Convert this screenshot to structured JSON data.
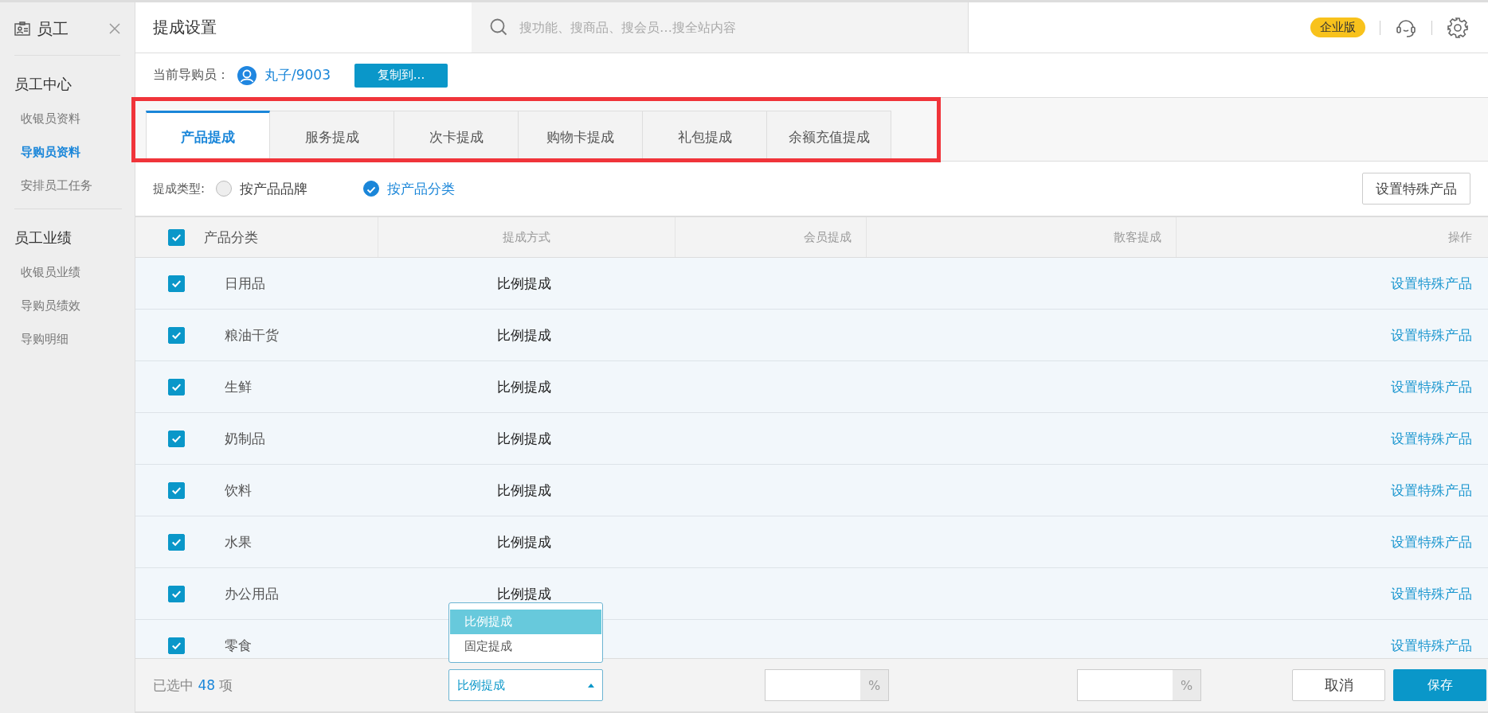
{
  "sidebar": {
    "title": "员工",
    "groups": [
      {
        "title": "员工中心",
        "items": [
          {
            "label": "收银员资料",
            "selected": false
          },
          {
            "label": "导购员资料",
            "selected": true
          },
          {
            "label": "安排员工任务",
            "selected": false
          }
        ]
      },
      {
        "title": "员工业绩",
        "items": [
          {
            "label": "收银员业绩",
            "selected": false
          },
          {
            "label": "导购员绩效",
            "selected": false
          },
          {
            "label": "导购明细",
            "selected": false
          }
        ]
      }
    ]
  },
  "header": {
    "title": "提成设置",
    "search": {
      "placeholder": "搜功能、搜商品、搜会员…搜全站内容"
    },
    "edition_badge": "企业版"
  },
  "staff_bar": {
    "label": "当前导购员：",
    "staff": "丸子/9003",
    "copy_button": "复制到..."
  },
  "tabs": [
    {
      "label": "产品提成",
      "selected": true
    },
    {
      "label": "服务提成",
      "selected": false
    },
    {
      "label": "次卡提成",
      "selected": false
    },
    {
      "label": "购物卡提成",
      "selected": false
    },
    {
      "label": "礼包提成",
      "selected": false
    },
    {
      "label": "余额充值提成",
      "selected": false
    }
  ],
  "commission_type": {
    "label": "提成类型:",
    "options": [
      {
        "label": "按产品品牌",
        "selected": false
      },
      {
        "label": "按产品分类",
        "selected": true
      }
    ],
    "special_button": "设置特殊产品"
  },
  "table": {
    "all_checked": true,
    "columns": [
      "产品分类",
      "提成方式",
      "会员提成",
      "散客提成",
      "操作"
    ],
    "rows": [
      {
        "category": "日用品",
        "method": "比例提成",
        "action": "设置特殊产品",
        "checked": true
      },
      {
        "category": "粮油干货",
        "method": "比例提成",
        "action": "设置特殊产品",
        "checked": true
      },
      {
        "category": "生鲜",
        "method": "比例提成",
        "action": "设置特殊产品",
        "checked": true
      },
      {
        "category": "奶制品",
        "method": "比例提成",
        "action": "设置特殊产品",
        "checked": true
      },
      {
        "category": "饮料",
        "method": "比例提成",
        "action": "设置特殊产品",
        "checked": true
      },
      {
        "category": "水果",
        "method": "比例提成",
        "action": "设置特殊产品",
        "checked": true
      },
      {
        "category": "办公用品",
        "method": "比例提成",
        "action": "设置特殊产品",
        "checked": true
      },
      {
        "category": "零食",
        "action": "设置特殊产品",
        "checked": true
      }
    ]
  },
  "footer": {
    "selected_prefix": "已选中",
    "selected_count": "48",
    "selected_suffix": "项",
    "method_select": {
      "value": "比例提成",
      "options": [
        {
          "label": "比例提成",
          "selected": true
        },
        {
          "label": "固定提成",
          "selected": false
        }
      ]
    },
    "member_unit": "%",
    "guest_unit": "%",
    "cancel_button": "取消",
    "save_button": "保存"
  }
}
